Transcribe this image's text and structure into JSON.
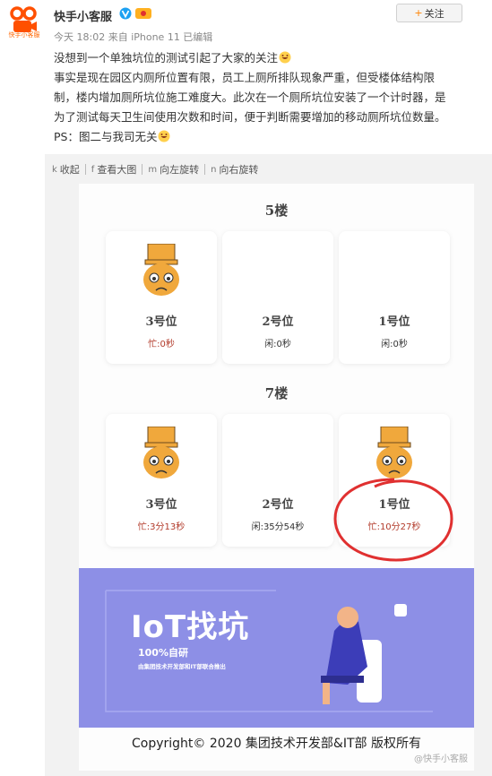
{
  "post": {
    "author": "快手小客服",
    "avatar_caption": "快手小客服",
    "meta": "今天 18:02 来自 iPhone 11   已编辑",
    "follow_label": "关注",
    "lines": [
      "没想到一个单独坑位的测试引起了大家的关注",
      "事实是现在园区内厕所位置有限，员工上厕所排队现象严重，但受楼体结构限",
      "制，楼内增加厕所坑位施工难度大。此次在一个厕所坑位安装了一个计时器，是",
      "为了测试每天卫生间使用次数和时间，便于判断需要增加的移动厕所坑位数量。",
      "PS：图二与我司无关"
    ]
  },
  "toolbar": {
    "collapse": "收起",
    "view_large": "查看大图",
    "rotate_left": "向左旋转",
    "rotate_right": "向右旋转",
    "collapse_icon": "k",
    "view_icon": "f",
    "left_icon": "m",
    "right_icon": "n"
  },
  "image": {
    "floors": [
      {
        "title": "5楼",
        "stalls": [
          {
            "label": "3号位",
            "status": "忙:0秒",
            "busy": true
          },
          {
            "label": "2号位",
            "status": "闲:0秒",
            "busy": false
          },
          {
            "label": "1号位",
            "status": "闲:0秒",
            "busy": false
          }
        ]
      },
      {
        "title": "7楼",
        "stalls": [
          {
            "label": "3号位",
            "status": "忙:3分13秒",
            "busy": true
          },
          {
            "label": "2号位",
            "status": "闲:35分54秒",
            "busy": false
          },
          {
            "label": "1号位",
            "status": "忙:10分27秒",
            "busy": true
          }
        ]
      }
    ],
    "banner": {
      "title": "IoT找坑",
      "subtitle": "100%自研",
      "tagline": "由集团技术开发部和IT部联合推出"
    },
    "copyright": "Copyright© 2020 集团技术开发部&IT部 版权所有",
    "watermark": "@快手小客服"
  },
  "colors": {
    "busy": "#b23a2a",
    "banner_bg": "#8d8fe6",
    "accent": "#ff8200",
    "circle": "#e03030"
  }
}
